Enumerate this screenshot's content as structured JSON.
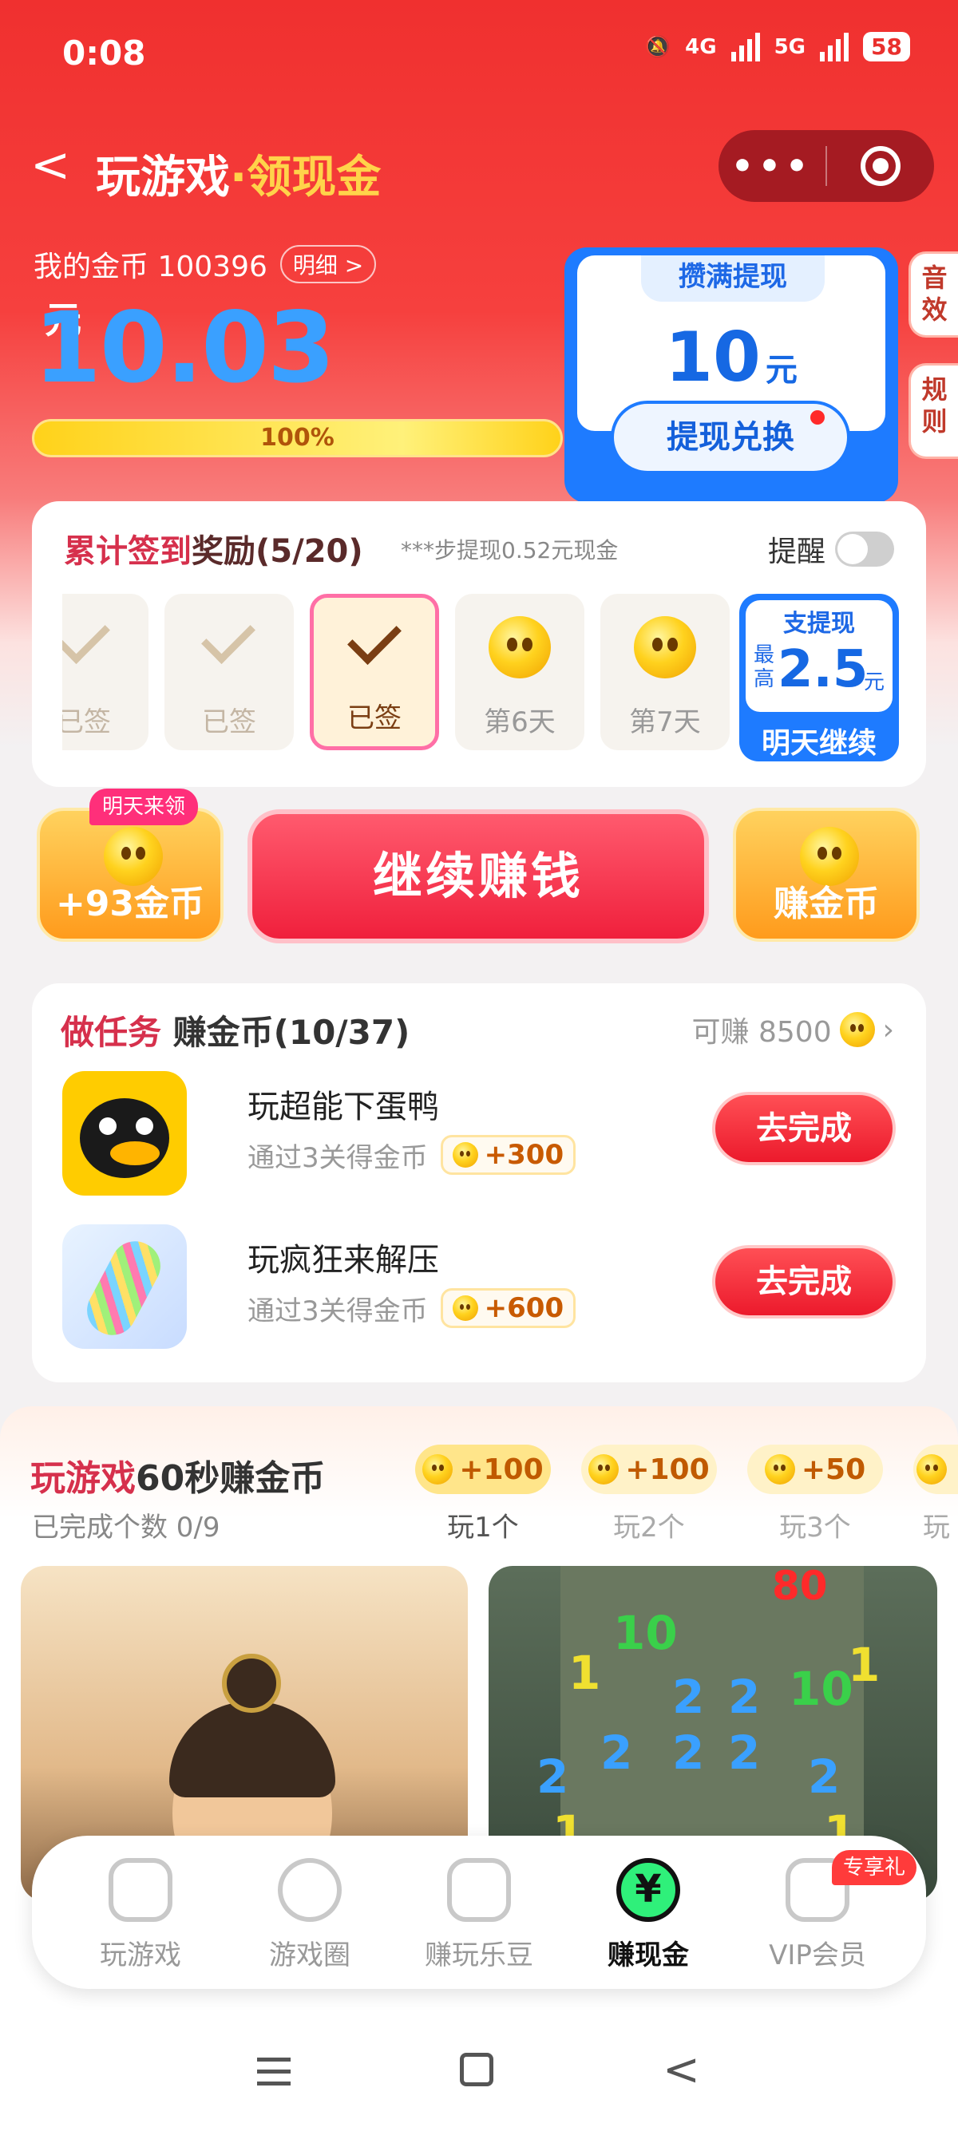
{
  "status_bar": {
    "time": "0:08",
    "net1": "4G",
    "net2": "5G",
    "battery": "58"
  },
  "nav": {
    "title_main": "玩游戏",
    "title_dot": "·",
    "title_accent": "领现金"
  },
  "wallet": {
    "coin_label": "我的金币",
    "coin_count": "100396",
    "detail_label": "明细 >",
    "amount": "10.03",
    "unit": "元",
    "progress_text": "100%",
    "progress": 1.0
  },
  "withdraw_card": {
    "tag": "攒满提现",
    "value": "10",
    "unit": "元",
    "button": "提现兑换"
  },
  "side_tabs": [
    "音效",
    "规则"
  ],
  "signin": {
    "title_a": "累计签到",
    "title_b": "奖励",
    "count": "(5/20)",
    "subtitle": "***步提现0.52元现金",
    "remind_label": "提醒",
    "days": [
      {
        "label": "已签",
        "state": "done"
      },
      {
        "label": "已签",
        "state": "done"
      },
      {
        "label": "已签",
        "state": "today"
      },
      {
        "label": "第6天",
        "state": "coin"
      },
      {
        "label": "第7天",
        "state": "coin"
      }
    ],
    "tomorrow": {
      "top": "支提现",
      "max": "最高",
      "value": "2.5",
      "unit": "元",
      "footer": "明天继续"
    }
  },
  "actions": {
    "badge": "明天来领",
    "left_label": "+93金币",
    "main": "继续赚钱",
    "right_label": "赚金币"
  },
  "tasks": {
    "title_a": "做任务",
    "title_b": "赚金币",
    "count": "(10/37)",
    "earn_label": "可赚 8500",
    "items": [
      {
        "name": "玩超能下蛋鸭",
        "desc": "通过3关得金币",
        "reward": "+300",
        "button": "去完成"
      },
      {
        "name": "玩疯狂来解压",
        "desc": "通过3关得金币",
        "reward": "+600",
        "button": "去完成"
      }
    ]
  },
  "games": {
    "title_a": "玩游戏",
    "title_b": "60秒赚金币",
    "done_label": "已完成个数 0/9",
    "steps": [
      {
        "reward": "+100",
        "label": "玩1个"
      },
      {
        "reward": "+100",
        "label": "玩2个"
      },
      {
        "reward": "+50",
        "label": "玩3个"
      },
      {
        "reward": "",
        "label": "玩"
      }
    ],
    "thumb2_numbers": [
      "80",
      "10",
      "10",
      "2",
      "2",
      "2",
      "2",
      "2",
      "2",
      "2",
      "1",
      "1",
      "1",
      "1"
    ]
  },
  "tabbar": {
    "items": [
      {
        "label": "玩游戏"
      },
      {
        "label": "游戏圈"
      },
      {
        "label": "赚玩乐豆"
      },
      {
        "label": "赚现金",
        "glyph": "¥"
      },
      {
        "label": "VIP会员"
      }
    ],
    "vip_badge": "专享礼"
  },
  "colors": {
    "brand_red": "#f0302f",
    "accent_gold": "#ffd34a",
    "blue": "#1e7bff"
  }
}
